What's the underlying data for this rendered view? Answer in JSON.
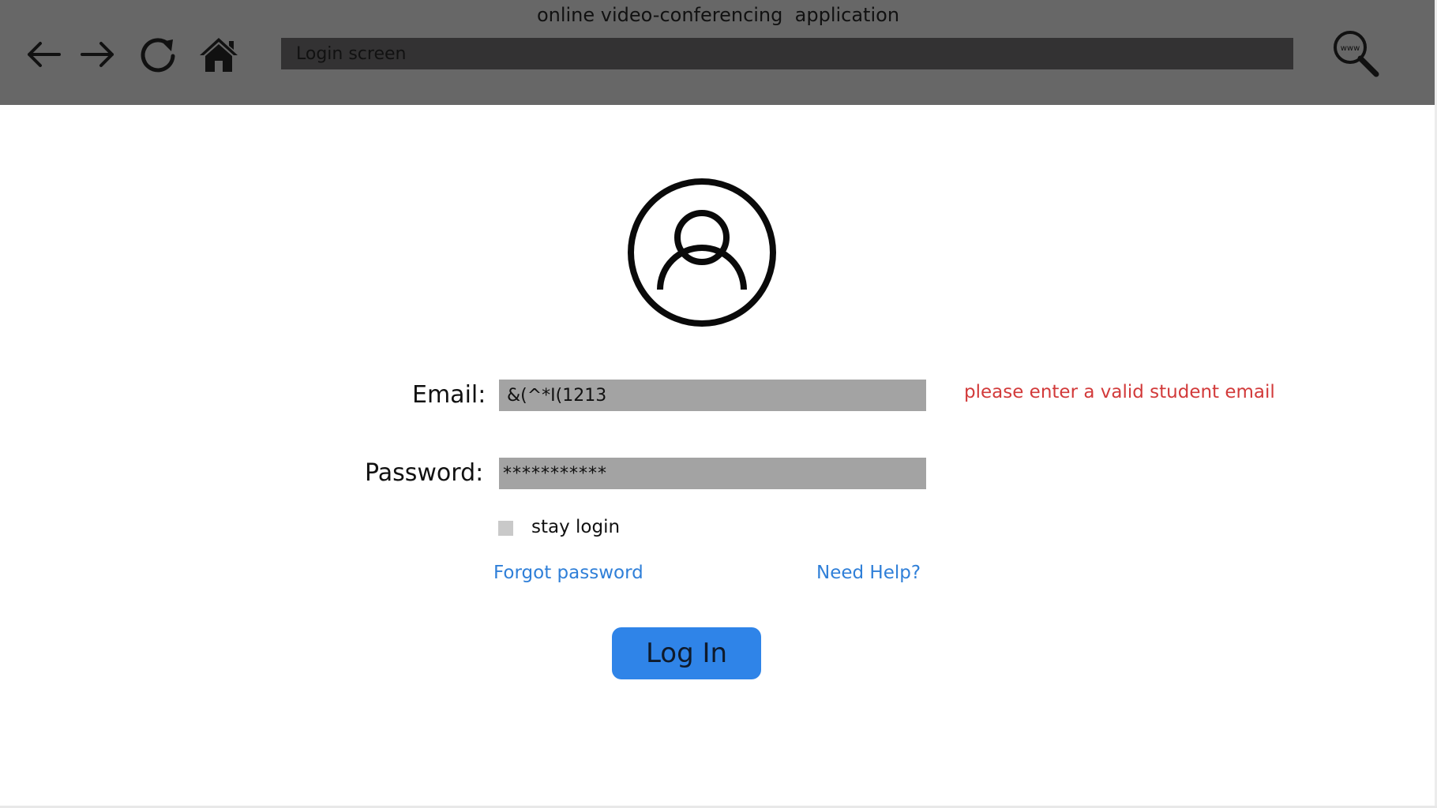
{
  "window": {
    "title": "online video-conferencing  application"
  },
  "toolbar": {
    "back_icon": "arrow-left-icon",
    "forward_icon": "arrow-right-icon",
    "reload_icon": "reload-icon",
    "home_icon": "home-icon",
    "address": "Login screen",
    "web_search_icon": "www-search-icon",
    "web_search_text": "www"
  },
  "login": {
    "avatar_icon": "user-circle-icon",
    "email_label": "Email:",
    "email_value": "&(^*I(1213",
    "email_error": "please enter a valid student email",
    "password_label": "Password:",
    "password_value": "***********",
    "stay_login_label": "stay login",
    "stay_login_checked": false,
    "forgot_password": "Forgot password",
    "need_help": "Need Help?",
    "login_button": "Log In"
  },
  "colors": {
    "chrome_background": "#676767",
    "address_bar": "#333233",
    "field_background": "#a3a3a3",
    "error_text": "#d23a3a",
    "link_text": "#2f7fd8",
    "primary_button": "#2f84e8"
  }
}
